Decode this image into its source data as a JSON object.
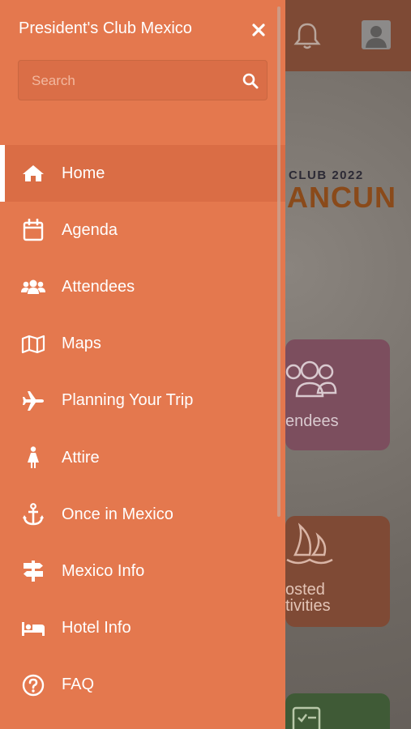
{
  "background": {
    "banner_line1": "CLUB 2022",
    "banner_line2": "ANCUN",
    "tiles": [
      {
        "label_line1": "endees",
        "label_line2": ""
      },
      {
        "label_line1": "osted",
        "label_line2": "tivities"
      }
    ]
  },
  "drawer": {
    "title": "President's Club Mexico",
    "search_placeholder": "Search",
    "items": [
      {
        "label": "Home",
        "icon": "home-icon",
        "active": true
      },
      {
        "label": "Agenda",
        "icon": "calendar-icon",
        "active": false
      },
      {
        "label": "Attendees",
        "icon": "users-icon",
        "active": false
      },
      {
        "label": "Maps",
        "icon": "map-icon",
        "active": false
      },
      {
        "label": "Planning Your Trip",
        "icon": "plane-icon",
        "active": false
      },
      {
        "label": "Attire",
        "icon": "person-dress-icon",
        "active": false
      },
      {
        "label": "Once in Mexico",
        "icon": "anchor-icon",
        "active": false
      },
      {
        "label": "Mexico Info",
        "icon": "signpost-icon",
        "active": false
      },
      {
        "label": "Hotel Info",
        "icon": "bed-icon",
        "active": false
      },
      {
        "label": "FAQ",
        "icon": "question-circle-icon",
        "active": false
      }
    ]
  },
  "colors": {
    "drawer_bg": "#e4784e",
    "active_item_bg": "#da6d45"
  }
}
